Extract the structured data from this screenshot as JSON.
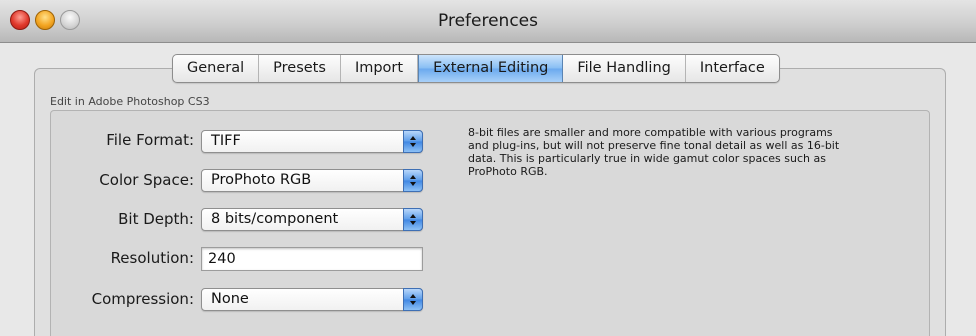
{
  "window": {
    "title": "Preferences"
  },
  "tabs": [
    {
      "label": "General",
      "selected": false
    },
    {
      "label": "Presets",
      "selected": false
    },
    {
      "label": "Import",
      "selected": false
    },
    {
      "label": "External Editing",
      "selected": true
    },
    {
      "label": "File Handling",
      "selected": false
    },
    {
      "label": "Interface",
      "selected": false
    }
  ],
  "section": {
    "label": "Edit in Adobe Photoshop CS3"
  },
  "form": {
    "file_format": {
      "label": "File Format:",
      "value": "TIFF"
    },
    "color_space": {
      "label": "Color Space:",
      "value": "ProPhoto RGB"
    },
    "bit_depth": {
      "label": "Bit Depth:",
      "value": "8 bits/component"
    },
    "resolution": {
      "label": "Resolution:",
      "value": "240"
    },
    "compression": {
      "label": "Compression:",
      "value": "None"
    }
  },
  "description": {
    "lines": [
      "8-bit files are smaller and more compatible with various programs",
      "and plug-ins, but will not preserve fine tonal detail as well as 16-bit",
      "data. This is particularly true in wide gamut color spaces such as",
      "ProPhoto RGB."
    ]
  },
  "colors": {
    "selected_tab": "#86bdf4",
    "popup_arrow": "#5b9cea",
    "close_button": "#e0392c",
    "minimize_button": "#f3a623"
  }
}
